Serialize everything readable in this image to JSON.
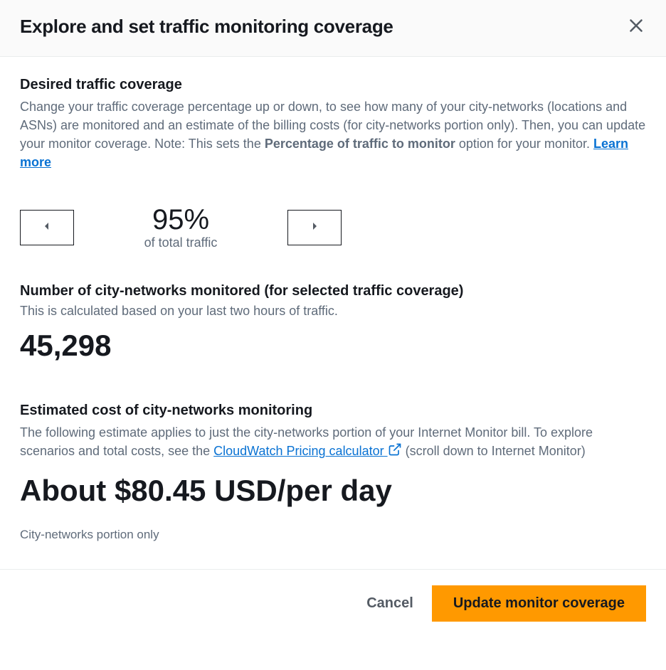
{
  "header": {
    "title": "Explore and set traffic monitoring coverage"
  },
  "coverage": {
    "section_title": "Desired traffic coverage",
    "desc_part1": "Change your traffic coverage percentage up or down, to see how many of your city-networks (locations and ASNs) are monitored and an estimate of the billing costs (for city-networks portion only). Then, you can update your monitor coverage. Note: This sets the ",
    "desc_bold": "Percentage of traffic to monitor",
    "desc_part2": " option for your monitor. ",
    "learn_more": "Learn more",
    "percent_value": "95%",
    "percent_caption": "of total traffic"
  },
  "city_networks": {
    "section_title": "Number of city-networks monitored (for selected traffic coverage)",
    "sub_desc": "This is calculated based on your last two hours of traffic.",
    "value": "45,298"
  },
  "cost": {
    "section_title": "Estimated cost of city-networks monitoring",
    "desc_part1": "The following estimate applies to just the city-networks portion of your Internet Monitor bill. To explore scenarios and total costs, see the ",
    "link_text": "CloudWatch Pricing calculator",
    "desc_part2": " (scroll down to Internet Monitor)",
    "value": "About $80.45 USD/per day",
    "note": "City-networks portion only"
  },
  "footer": {
    "cancel": "Cancel",
    "update": "Update monitor coverage"
  }
}
